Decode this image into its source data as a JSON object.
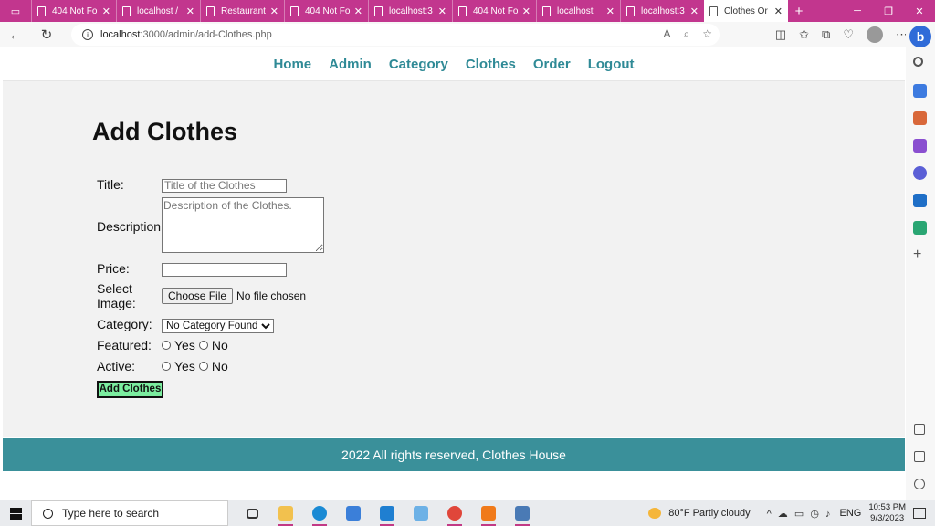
{
  "browser": {
    "tabs": [
      {
        "title": "404 Not Fo",
        "active": false
      },
      {
        "title": "localhost /",
        "active": false
      },
      {
        "title": "Restaurant",
        "active": false
      },
      {
        "title": "404 Not Fo",
        "active": false
      },
      {
        "title": "localhost:3",
        "active": false
      },
      {
        "title": "404 Not Fo",
        "active": false
      },
      {
        "title": "localhost",
        "active": false
      },
      {
        "title": "localhost:3",
        "active": false
      },
      {
        "title": "Clothes Or",
        "active": true
      }
    ],
    "url_host": "localhost",
    "url_path": ":3000/admin/add-Clothes.php",
    "accent_color": "#c2368e"
  },
  "nav": {
    "items": [
      "Home",
      "Admin",
      "Category",
      "Clothes",
      "Order",
      "Logout"
    ],
    "color": "#2f8a96"
  },
  "page": {
    "heading": "Add Clothes",
    "form": {
      "title_label": "Title:",
      "title_placeholder": "Title of the Clothes",
      "description_label": "Description:",
      "description_placeholder": "Description of the Clothes.",
      "price_label": "Price:",
      "image_label": "Select Image:",
      "file_button": "Choose File",
      "file_status": "No file chosen",
      "category_label": "Category:",
      "category_selected": "No Category Found",
      "featured_label": "Featured:",
      "active_label": "Active:",
      "yes": "Yes",
      "no": "No",
      "submit": "Add Clothes"
    },
    "footer": "2022 All rights reserved, Clothes House"
  },
  "taskbar": {
    "search_placeholder": "Type here to search",
    "weather": "80°F  Partly cloudy",
    "language": "ENG",
    "time": "10:53 PM",
    "date": "9/3/2023"
  }
}
